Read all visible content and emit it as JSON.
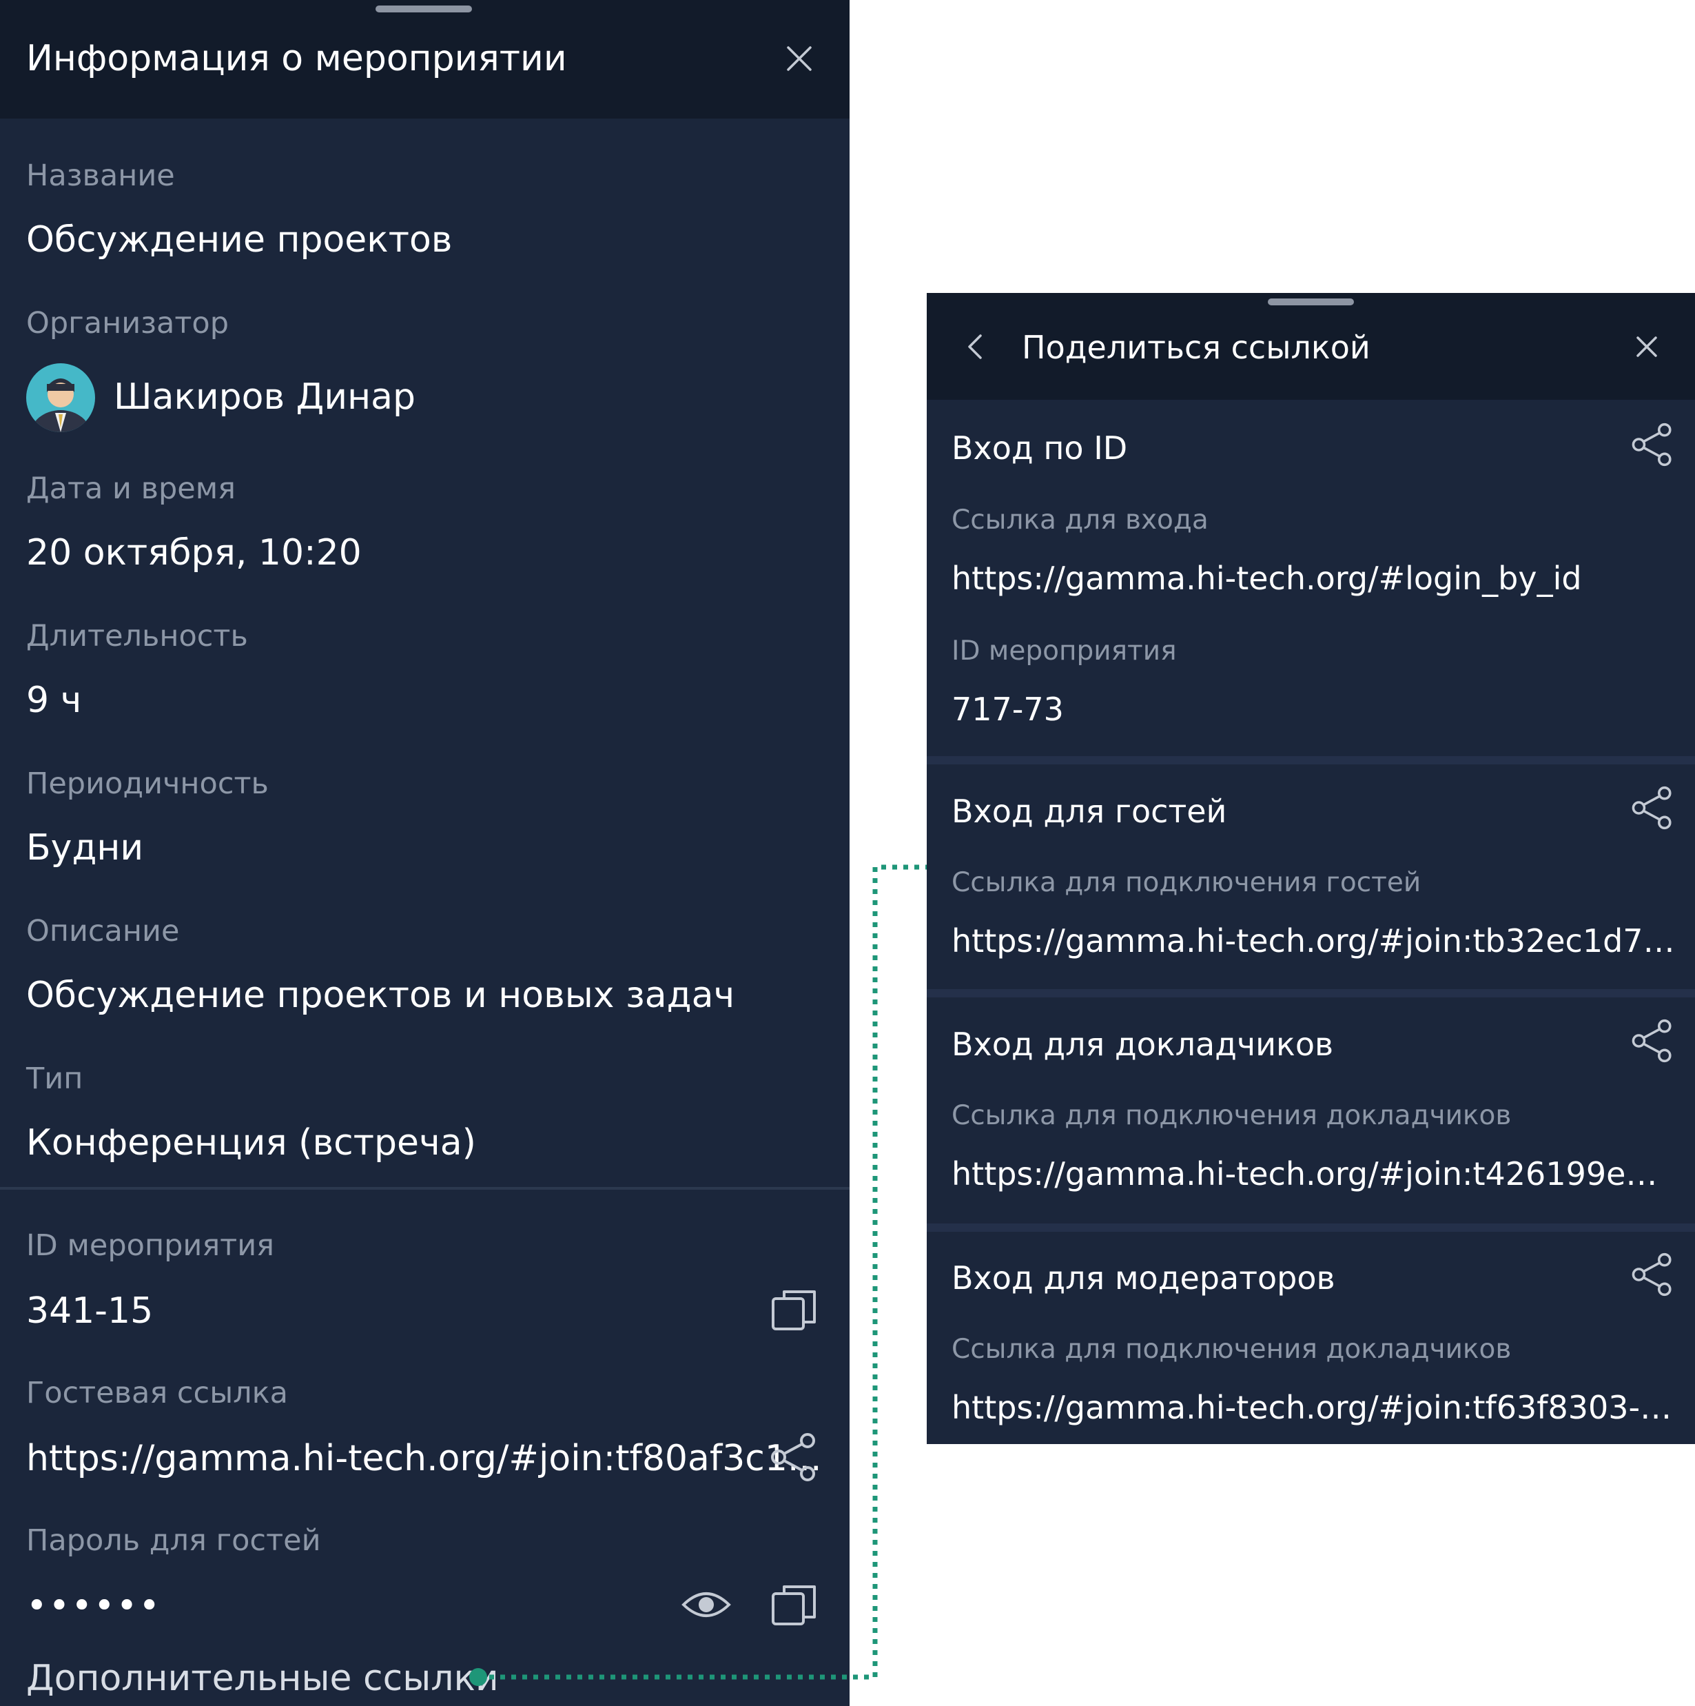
{
  "event_info": {
    "title": "Информация о мероприятии",
    "fields": {
      "name": {
        "label": "Название",
        "value": "Обсуждение проектов"
      },
      "organizer": {
        "label": "Организатор",
        "value": "Шакиров Динар"
      },
      "datetime": {
        "label": "Дата и время",
        "value": "20 октября, 10:20"
      },
      "duration": {
        "label": "Длительность",
        "value": "9 ч"
      },
      "recurrence": {
        "label": "Периодичность",
        "value": "Будни"
      },
      "description": {
        "label": "Описание",
        "value": "Обсуждение проектов и новых задач"
      },
      "type": {
        "label": "Тип",
        "value": "Конференция (встреча)"
      },
      "event_id": {
        "label": "ID мероприятия",
        "value": "341-15"
      },
      "guest_link": {
        "label": "Гостевая ссылка",
        "value": "https://gamma.hi-tech.org/#join:tf80af3c1..."
      },
      "guest_password": {
        "label": "Пароль для гостей",
        "value": "••••••"
      }
    },
    "more_links": "Дополнительные ссылки"
  },
  "share_links": {
    "title": "Поделиться ссылкой",
    "sections": [
      {
        "title": "Вход по ID",
        "rows": [
          {
            "label": "Ссылка для входа",
            "value": "https://gamma.hi-tech.org/#login_by_id"
          },
          {
            "label": "ID мероприятия",
            "value": "717-73"
          }
        ]
      },
      {
        "title": "Вход для гостей",
        "rows": [
          {
            "label": "Ссылка для подключения гостей",
            "value": "https://gamma.hi-tech.org/#join:tb32ec1d7-3c0..."
          }
        ]
      },
      {
        "title": "Вход для докладчиков",
        "rows": [
          {
            "label": "Ссылка для подключения докладчиков",
            "value": "https://gamma.hi-tech.org/#join:t426199e2-638..."
          }
        ]
      },
      {
        "title": "Вход для модераторов",
        "rows": [
          {
            "label": "Ссылка для подключения докладчиков",
            "value": "https://gamma.hi-tech.org/#join:tf63f8303-3a7..."
          }
        ]
      }
    ]
  },
  "colors": {
    "panel_bg": "#1b263b",
    "header_bg": "#121b2a",
    "label": "#8d97a7",
    "text": "#ffffff",
    "connector": "#1e9678"
  },
  "icons": [
    "close-icon",
    "back-chevron-icon",
    "share-icon",
    "copy-icon",
    "eye-icon",
    "avatar"
  ]
}
